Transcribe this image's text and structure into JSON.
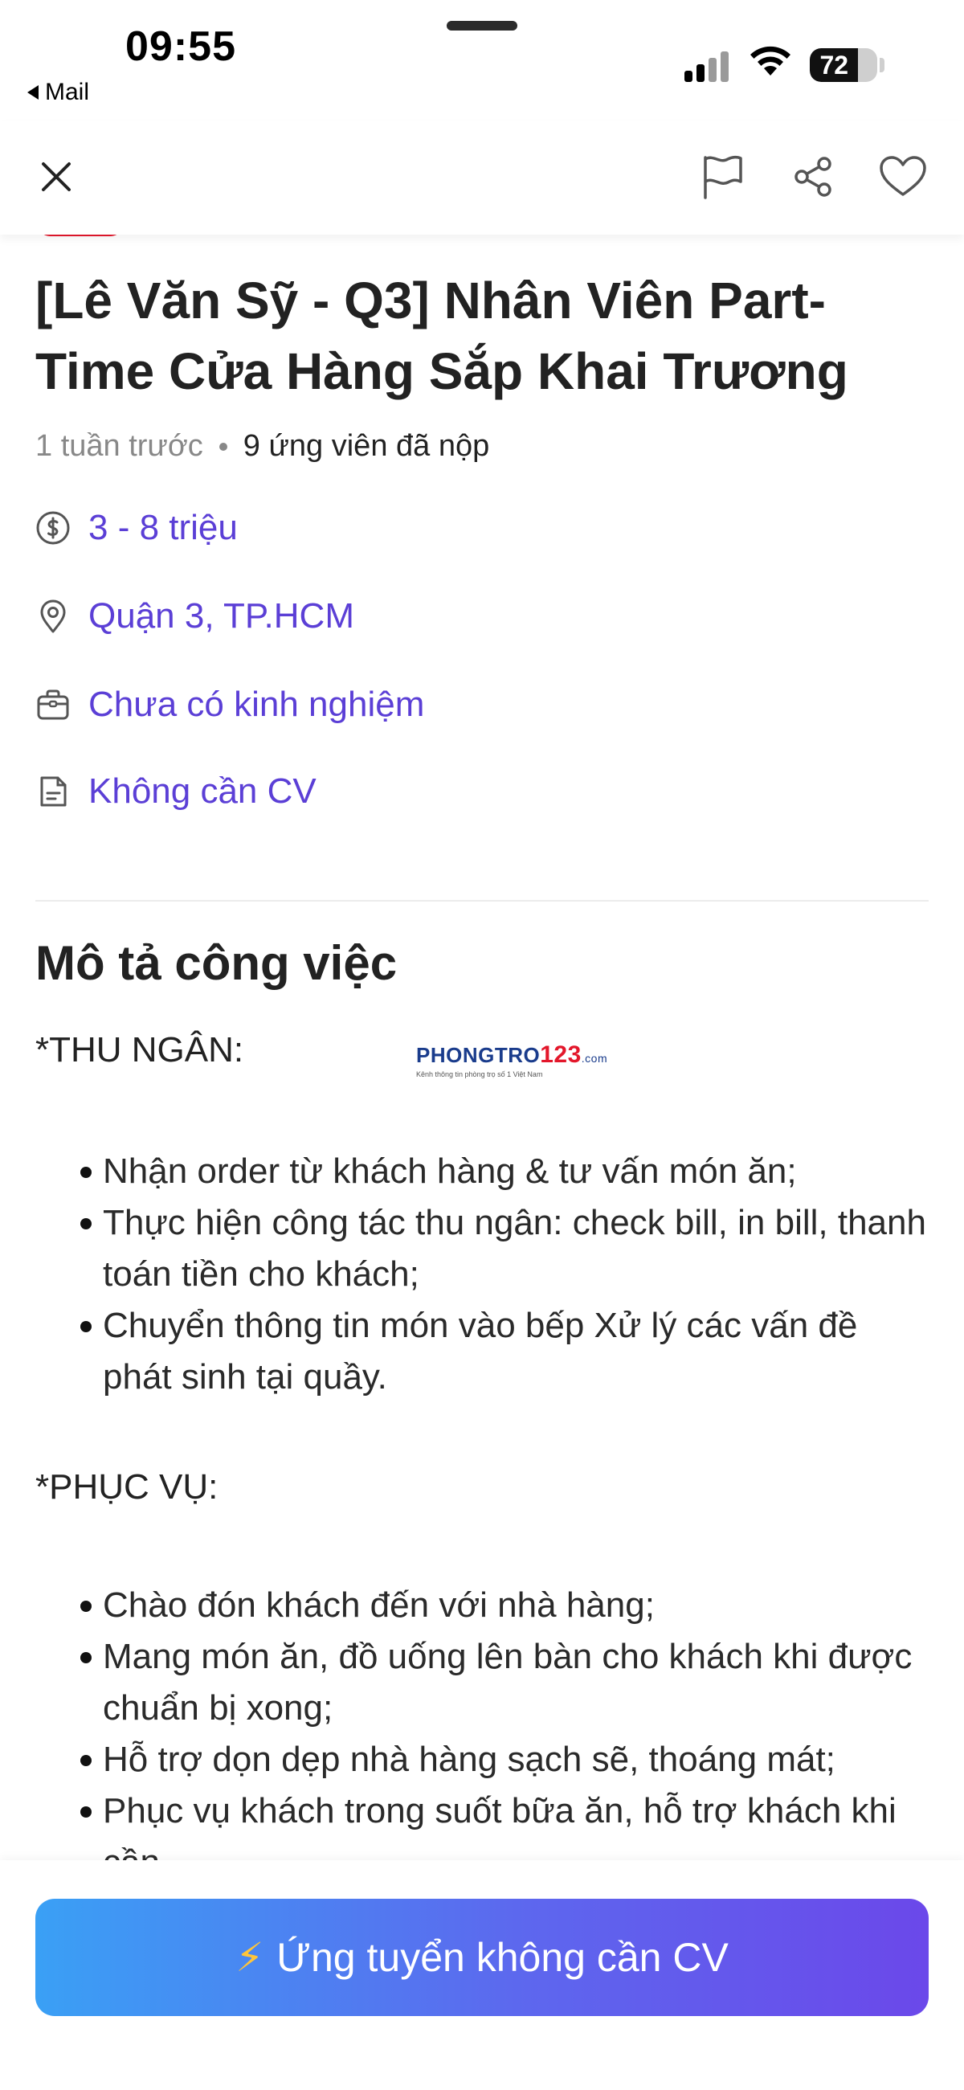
{
  "status_bar": {
    "time": "09:55",
    "back_app": "Mail",
    "battery_percent": "72",
    "battery_level": 0.72
  },
  "nav": {
    "icons": [
      "close-icon",
      "flag-icon",
      "share-icon",
      "heart-icon"
    ]
  },
  "job": {
    "title": "[Lê Văn Sỹ - Q3] Nhân Viên Part-Time Cửa Hàng Sắp Khai Trương",
    "posted": "1 tuần trước",
    "applicants": "9 ứng viên đã nộp",
    "salary": "3 - 8 triệu",
    "location": "Quận 3, TP.HCM",
    "experience": "Chưa có kinh nghiệm",
    "cv_requirement": "Không cần CV"
  },
  "description": {
    "section_title": "Mô tả công việc",
    "cashier": {
      "heading": "*THU NGÂN:",
      "items": [
        "Nhận order từ khách hàng & tư vấn món ăn;",
        "Thực hiện công tác thu ngân: check bill, in bill, thanh toán tiền cho khách;",
        "Chuyển thông tin món vào bếp Xử lý các vấn đề phát sinh tại quầy."
      ]
    },
    "service": {
      "heading": "*PHỤC VỤ:",
      "items": [
        "Chào đón khách đến với nhà hàng;",
        "Mang món ăn, đồ uống lên bàn cho khách khi được chuẩn bị xong;",
        "Hỗ trợ dọn dẹp nhà hàng sạch sẽ, thoáng mát;",
        "Phục vụ khách trong suốt bữa ăn, hỗ trợ khách khi cần."
      ]
    }
  },
  "watermark": {
    "brand": "PHONGTRO",
    "number": "123",
    "domain": ".com",
    "tagline": "Kênh thông tin phòng trọ số 1 Việt Nam"
  },
  "apply": {
    "label": "Ứng tuyển không cần CV",
    "icon": "⚡"
  },
  "colors": {
    "accent": "#5b3fd6",
    "brand_red": "#e3172b",
    "button_gradient_start": "#3aa0f5",
    "button_gradient_end": "#6b48ea"
  }
}
